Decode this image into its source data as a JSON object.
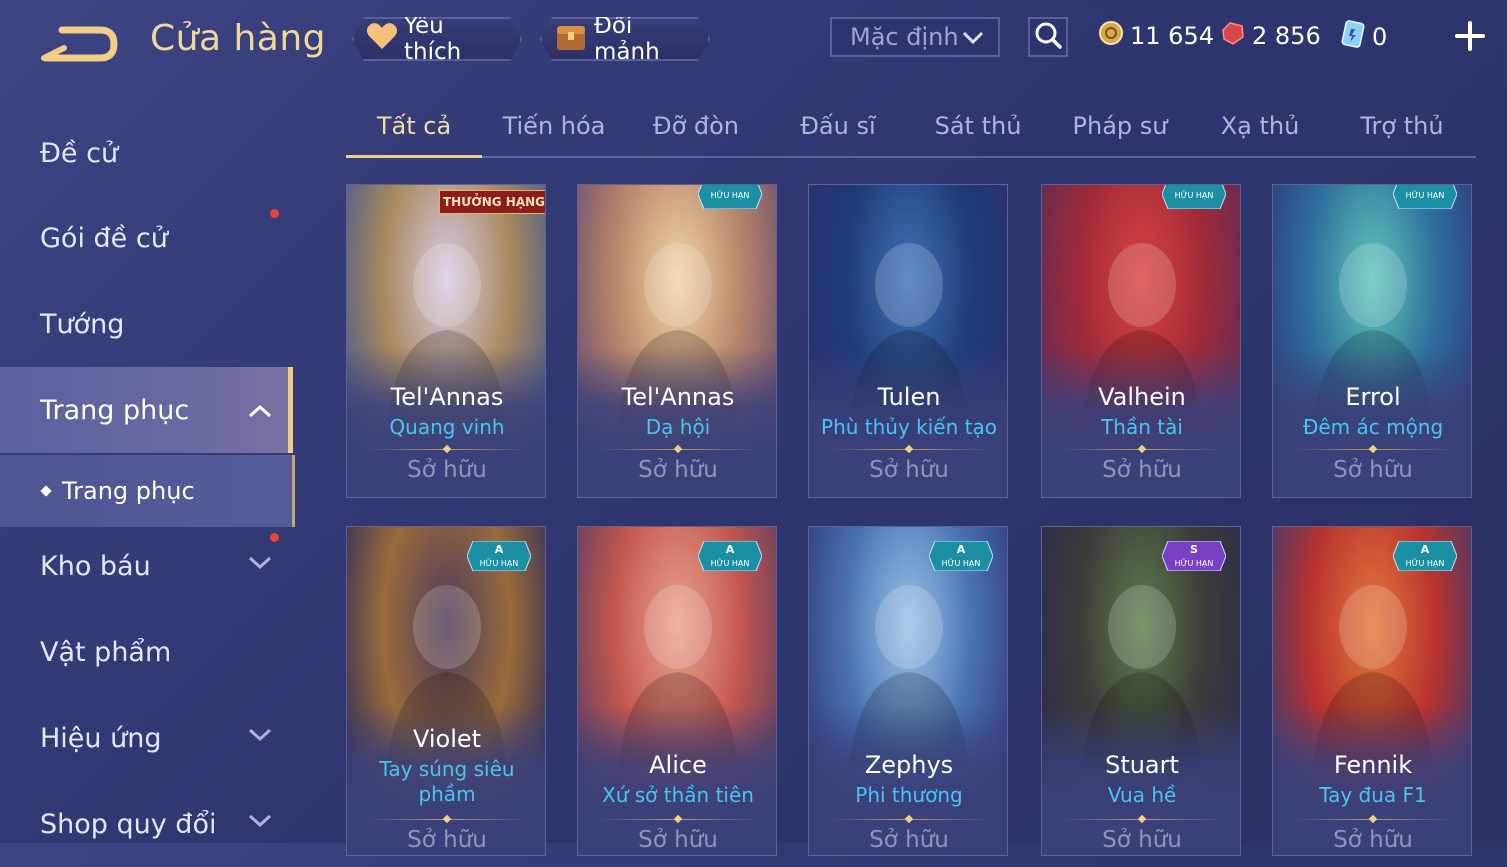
{
  "header": {
    "title": "Cửa hàng",
    "favorites_label": "Yêu thích",
    "shards_label": "Đổi mảnh",
    "sort_value": "Mặc định",
    "gold": "11 654",
    "ruby": "2 856",
    "voucher": "0"
  },
  "sidebar": {
    "items": [
      {
        "label": "Đề cử"
      },
      {
        "label": "Gói đề cử"
      },
      {
        "label": "Tướng"
      },
      {
        "label": "Trang phục"
      },
      {
        "label": "Trang phục"
      },
      {
        "label": "Kho báu"
      },
      {
        "label": "Vật phẩm"
      },
      {
        "label": "Hiệu ứng"
      },
      {
        "label": "Shop quy đổi"
      }
    ]
  },
  "tabs": [
    {
      "label": "Tất cả"
    },
    {
      "label": "Tiến hóa"
    },
    {
      "label": "Đỡ đòn"
    },
    {
      "label": "Đấu sĩ"
    },
    {
      "label": "Sát thủ"
    },
    {
      "label": "Pháp sư"
    },
    {
      "label": "Xạ thủ"
    },
    {
      "label": "Trợ thủ"
    }
  ],
  "cards": [
    {
      "hero": "Tel'Annas",
      "skin": "Quang vinh",
      "status": "Sở hữu",
      "badge": "THƯỞNG HẠNG",
      "palette": [
        "#d9cbe6",
        "#a88a5e",
        "#4a5a8a"
      ]
    },
    {
      "hero": "Tel'Annas",
      "skin": "Dạ hội",
      "status": "Sở hữu",
      "badge": "HỮU HẠN",
      "palette": [
        "#f1d6a6",
        "#b9866a",
        "#6c4f6e"
      ]
    },
    {
      "hero": "Tulen",
      "skin": "Phù thủy kiến tạo",
      "status": "Sở hữu",
      "badge": "",
      "palette": [
        "#3f73b6",
        "#1f3c78",
        "#2b2f6b"
      ]
    },
    {
      "hero": "Valhein",
      "skin": "Thần tài",
      "status": "Sở hữu",
      "badge": "HỮU HẠN",
      "palette": [
        "#d8433f",
        "#a02a3a",
        "#5c2a55"
      ]
    },
    {
      "hero": "Errol",
      "skin": "Đêm ác mộng",
      "status": "Sở hữu",
      "badge": "HỮU HẠN",
      "palette": [
        "#5fc7b9",
        "#2f6f9c",
        "#2c3d79"
      ]
    },
    {
      "hero": "Violet",
      "skin": "Tay súng siêu phầm",
      "status": "Sở hữu",
      "badge": "A HỮU HẠN",
      "palette": [
        "#4d3a5b",
        "#9a6b3b",
        "#2f2d56"
      ]
    },
    {
      "hero": "Alice",
      "skin": "Xứ sở thần tiên",
      "status": "Sở hữu",
      "badge": "A HỮU HẠN",
      "palette": [
        "#e9a48f",
        "#c4584e",
        "#5b3d5f"
      ]
    },
    {
      "hero": "Zephys",
      "skin": "Phi thương",
      "status": "Sở hữu",
      "badge": "A HỮU HẠN",
      "palette": [
        "#9bc3e6",
        "#4a72b3",
        "#313a78"
      ]
    },
    {
      "hero": "Stuart",
      "skin": "Vua hề",
      "status": "Sở hữu",
      "badge": "S HỮU HẠN",
      "palette": [
        "#5f7e4a",
        "#3c3b3a",
        "#2a2c4d"
      ]
    },
    {
      "hero": "Fennik",
      "skin": "Tay đua F1",
      "status": "Sở hữu",
      "badge": "A HỮU HẠN",
      "palette": [
        "#e37a3a",
        "#b9322e",
        "#3d3b6e"
      ]
    }
  ],
  "colors": {
    "accent_gold": "#f1cd86",
    "skin_name_blue": "#47c4f0",
    "notification_red": "#e8423c"
  }
}
